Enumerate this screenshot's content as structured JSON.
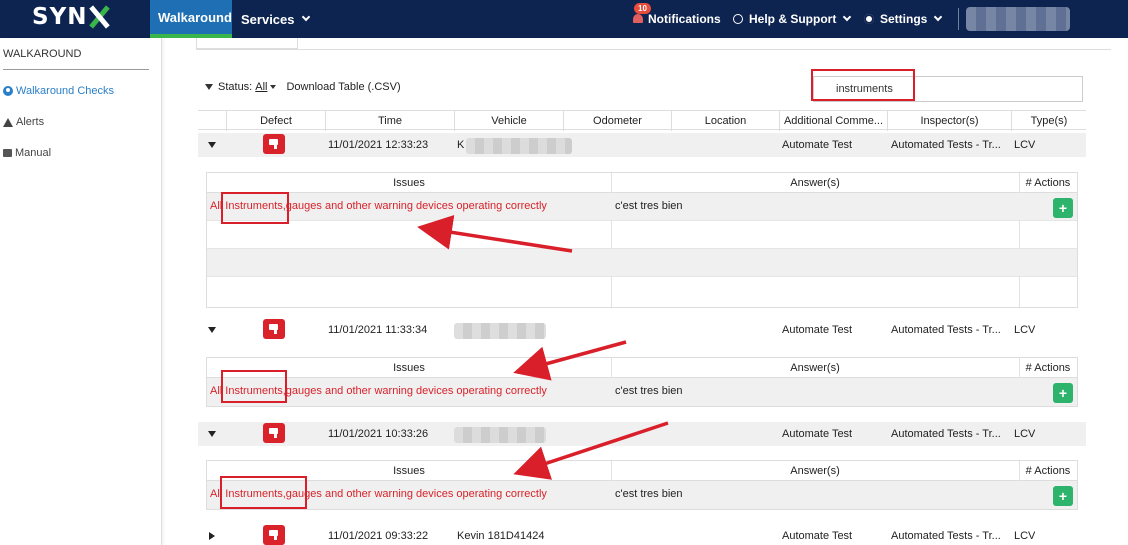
{
  "nav": {
    "logo": "SYNX",
    "walkaround": "Walkaround",
    "services": "Services",
    "notifications": "Notifications",
    "notifications_count": "10",
    "help": "Help & Support",
    "settings": "Settings"
  },
  "sidebar": {
    "heading": "WALKAROUND",
    "items": [
      {
        "label": "Walkaround Checks"
      },
      {
        "label": "Alerts"
      },
      {
        "label": "Manual"
      }
    ]
  },
  "toolbar": {
    "status_label": "Status:",
    "status_value": "All",
    "download": "Download Table (.CSV)",
    "search_value": "instruments"
  },
  "columns": [
    "Defect",
    "Time",
    "Vehicle",
    "Odometer",
    "Location",
    "Additional Comme...",
    "Inspector(s)",
    "Type(s)"
  ],
  "sub_columns": {
    "issues": "Issues",
    "answers": "Answer(s)",
    "actions": "# Actions"
  },
  "rows": [
    {
      "time": "11/01/2021 12:33:23",
      "vehicle": "K",
      "comment": "Automate Test",
      "inspector": "Automated Tests - Tr...",
      "type": "LCV",
      "issue": "All Instruments,gauges and other warning devices operating correctly",
      "answer": "c'est tres bien"
    },
    {
      "time": "11/01/2021 11:33:34",
      "vehicle": "",
      "comment": "Automate Test",
      "inspector": "Automated Tests - Tr...",
      "type": "LCV",
      "issue": "All Instruments,gauges and other warning devices operating correctly",
      "answer": "c'est tres bien"
    },
    {
      "time": "11/01/2021 10:33:26",
      "vehicle": "",
      "comment": "Automate Test",
      "inspector": "Automated Tests - Tr...",
      "type": "LCV",
      "issue": "All Instruments,gauges and other warning devices operating correctly",
      "answer": "c'est tres bien"
    },
    {
      "time": "11/01/2021 09:33:22",
      "vehicle": "Kevin 181D41424",
      "comment": "Automate Test",
      "inspector": "Automated Tests - Tr...",
      "type": "LCV"
    }
  ],
  "colors": {
    "nav": "#0d2350",
    "active_tab": "#1f6fb5",
    "accent_green": "#39b54a",
    "defect_red": "#d9222a",
    "annotation_red": "#d91f2a",
    "add_green": "#2db36b"
  }
}
